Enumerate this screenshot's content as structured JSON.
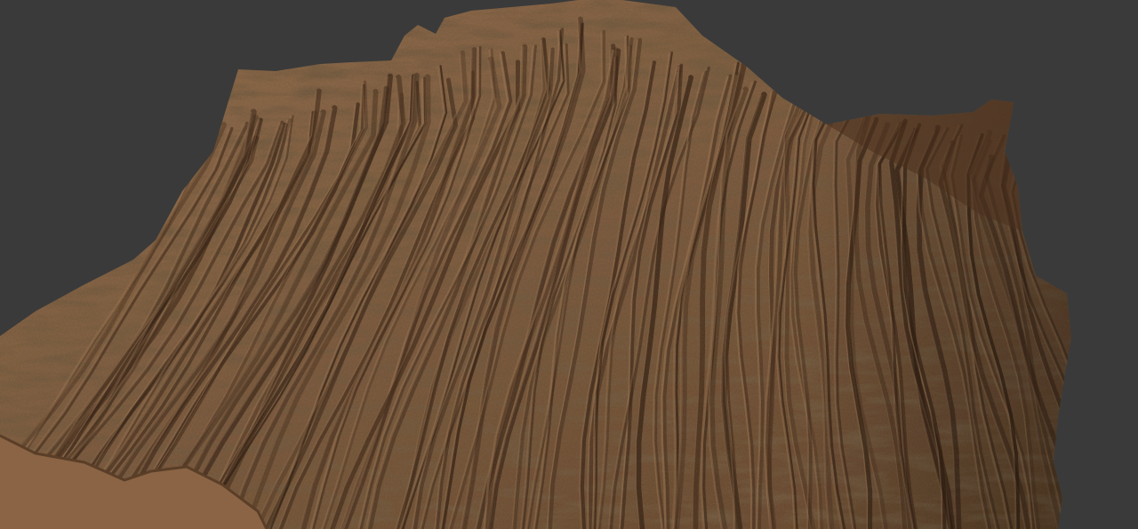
{
  "scene": {
    "background_color": "#3a3a3a",
    "subject": "terrain-mesh",
    "material_colors": {
      "highlight": "#9a7552",
      "mid": "#7a5a3e",
      "shadow": "#3e2818",
      "deep_shadow": "#2a190e",
      "underside": "#8a6444"
    }
  }
}
